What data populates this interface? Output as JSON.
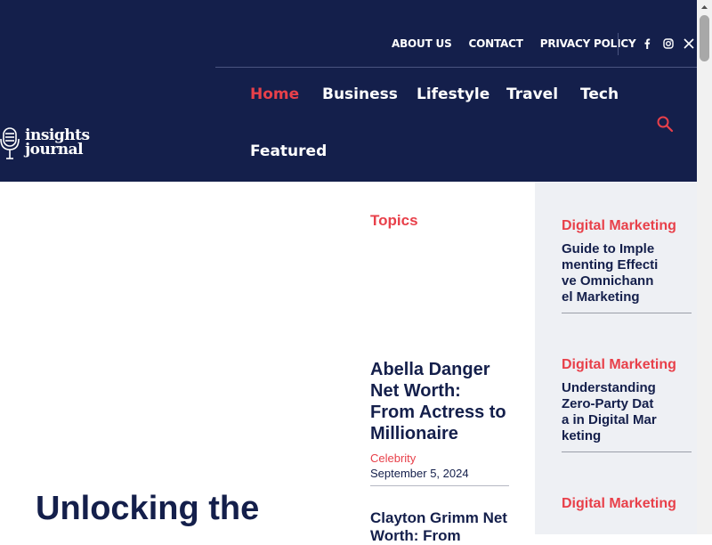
{
  "header": {
    "top_links": [
      "ABOUT US",
      "CONTACT",
      "PRIVACY POLICY"
    ],
    "social_icons": [
      "facebook-icon",
      "instagram-icon",
      "x-icon"
    ],
    "logo_text_1": "insights",
    "logo_text_2": "journal",
    "nav": [
      {
        "label": "Home",
        "active": true
      },
      {
        "label": "Business",
        "active": false
      },
      {
        "label": "Lifestyle",
        "active": false
      },
      {
        "label": "Travel",
        "active": false
      },
      {
        "label": "Tech",
        "active": false
      },
      {
        "label": "Featured",
        "active": false
      }
    ],
    "bg_color": "#141f4b",
    "accent_color": "#e8404a"
  },
  "hero": {
    "title": "Unlocking the"
  },
  "topics": {
    "label": "Topics",
    "articles": [
      {
        "title": "Abella Danger Net Worth: From Actress to Millionaire",
        "category": "Celebrity",
        "date": "September 5, 2024"
      },
      {
        "title": "Clayton Grimm Net Worth: From",
        "category": "",
        "date": ""
      }
    ]
  },
  "sidebar": {
    "items": [
      {
        "category": "Digital Marketing",
        "title": "Guide to Implementing Effective Omnichannel Marketing"
      },
      {
        "category": "Digital Marketing",
        "title": "Understanding Zero-Party Data in Digital Marketing"
      },
      {
        "category": "Digital Marketing",
        "title": ""
      }
    ]
  }
}
